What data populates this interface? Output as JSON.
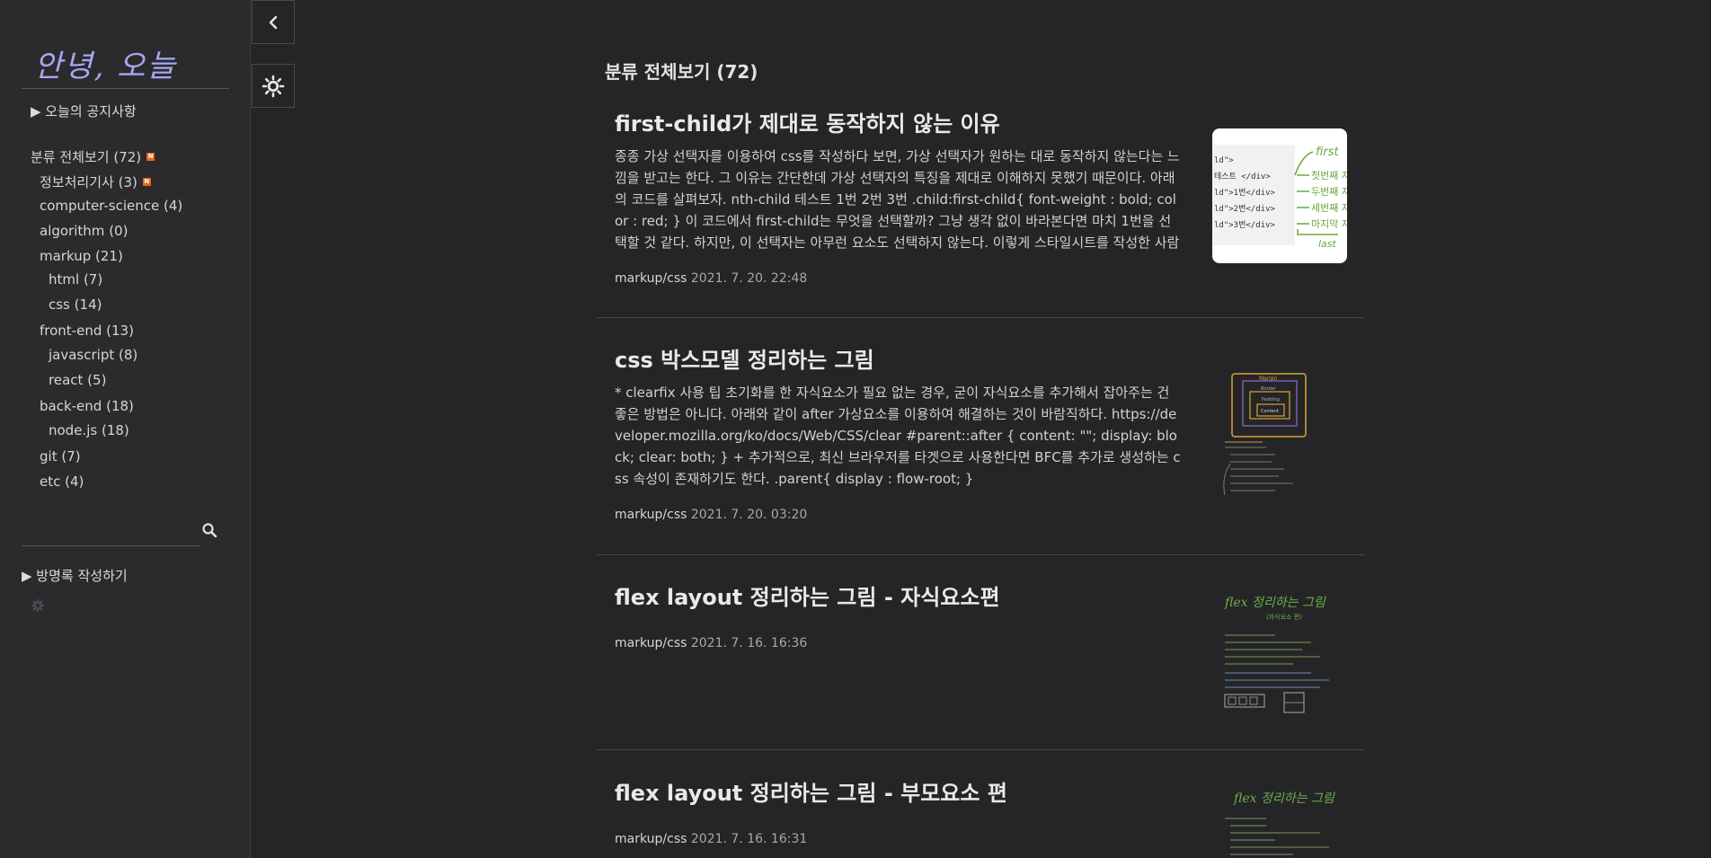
{
  "sidebar": {
    "blog_title": "안녕, 오늘",
    "notice_label": "▶ 오늘의 공지사항",
    "categories": [
      {
        "name": "분류 전체보기",
        "count": "(72)",
        "new": "N"
      },
      {
        "name": "정보처리기사",
        "count": "(3)",
        "new": "N"
      },
      {
        "name": "computer-science",
        "count": "(4)"
      },
      {
        "name": "algorithm",
        "count": "(0)"
      },
      {
        "name": "markup",
        "count": "(21)"
      },
      {
        "name": "html",
        "count": "(7)"
      },
      {
        "name": "css",
        "count": "(14)"
      },
      {
        "name": "front-end",
        "count": "(13)"
      },
      {
        "name": "javascript",
        "count": "(8)"
      },
      {
        "name": "react",
        "count": "(5)"
      },
      {
        "name": "back-end",
        "count": "(18)"
      },
      {
        "name": "node.js",
        "count": "(18)"
      },
      {
        "name": "git",
        "count": "(7)"
      },
      {
        "name": "etc",
        "count": "(4)"
      }
    ],
    "search": {
      "value": "",
      "placeholder": "",
      "icon": "search-icon"
    },
    "guestbook_label": "▶ 방명록 작성하기"
  },
  "controls": {
    "toggle_icon": "chevron-left-icon",
    "theme_icon": "sun-icon"
  },
  "main": {
    "header": "분류 전체보기 (72)",
    "posts": [
      {
        "title": "first-child가 제대로 동작하지 않는 이유",
        "excerpt": "종종 가상 선택자를 이용하여 css를 작성하다 보면, 가상 선택자가 원하는 대로 동작하지 않는다는 느낌을 받고는 한다. 그 이유는 간단한데 가상 선택자의 특징을 제대로 이해하지 못했기 때문이다. 아래의 코드를 살펴보자. nth-child 테스트 1번 2번 3번 .child:first-child{ font-weight : bold; color : red; } 이 코드에서 first-child는 무엇을 선택할까? 그냥 생각 없이 바라본다면 마치 1번을 선택할 것 같다. 하지만, 이 선택자는 아무런 요소도 선택하지 않는다. 이렇게 스타일시트를 작성한 사람은, 아마도…",
        "category": "markup/css",
        "date": "2021. 7. 20. 22:48",
        "thumb_lines": [
          "ld\">",
          "테스트 </div>",
          "ld\">1번</div>",
          "ld\">2번</div>",
          "ld\">3번</div>"
        ],
        "thumb_notes": [
          "first",
          "첫번째 자식",
          "두번째 자식",
          "세번째 자식",
          "마지막 자식",
          "last"
        ]
      },
      {
        "title": "css 박스모델 정리하는 그림",
        "excerpt": "* clearfix 사용 팁 초기화를 한 자식요소가 필요 없는 경우, 굳이 자식요소를 추가해서 잡아주는 건 좋은 방법은 아니다. 아래와 같이 after 가상요소를 이용하여 해결하는 것이 바람직하다. https://developer.mozilla.org/ko/docs/Web/CSS/clear #parent::after { content: \"\"; display: block; clear: both; } + 추가적으로, 최신 브라우저를 타겟으로 사용한다면 BFC를 추가로 생성하는 css 속성이 존재하기도 한다. .parent{ display : flow-root; }",
        "category": "markup/css",
        "date": "2021. 7. 20. 03:20",
        "thumb_labels": [
          "Margin",
          "Border",
          "Padding",
          "Content"
        ]
      },
      {
        "title": "flex layout 정리하는 그림 - 자식요소편",
        "excerpt": "",
        "category": "markup/css",
        "date": "2021. 7. 16. 16:36",
        "thumb_heading": "flex 정리하는 그림"
      },
      {
        "title": "flex layout 정리하는 그림 - 부모요소 편",
        "excerpt": "",
        "category": "markup/css",
        "date": "2021. 7. 16. 16:31",
        "thumb_heading": "flex 정리하는 그림"
      }
    ]
  }
}
